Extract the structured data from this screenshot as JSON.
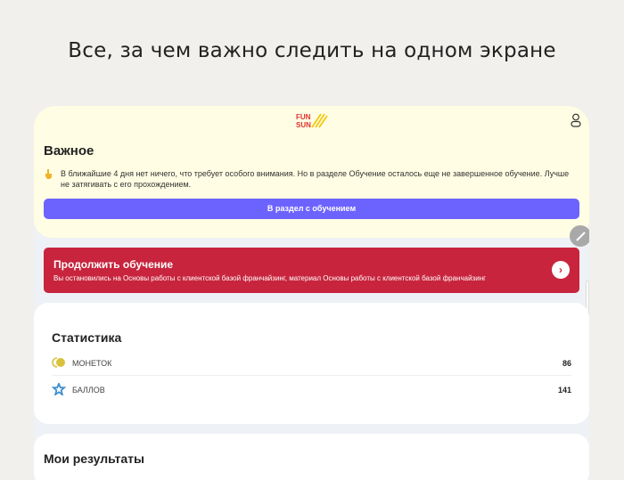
{
  "headline": "Все, за чем важно следить на одном экране",
  "logo": {
    "text_top": "FUN",
    "text_bottom": "SUN",
    "colors": {
      "red": "#e0302f",
      "yellow": "#f5c400"
    }
  },
  "important": {
    "title": "Важное",
    "message": "В ближайшие 4 дня нет ничего, что требует особого внимания. Но в разделе Обучение осталось еще не завершенное обучение. Лучше не затягивать с его прохождением.",
    "button": "В раздел с обучением"
  },
  "continue": {
    "title": "Продолжить обучение",
    "subtitle": "Вы остановились на Основы работы с клиентской базой франчайзинг, материал Основы работы с клиентской базой франчайзинг"
  },
  "stats": {
    "title": "Статистика",
    "items": [
      {
        "icon": "coins-icon",
        "label": "МОНЕТОК",
        "value": "86"
      },
      {
        "icon": "star-icon",
        "label": "БАЛЛОВ",
        "value": "141"
      }
    ]
  },
  "results": {
    "title": "Мои результаты"
  },
  "colors": {
    "accent": "#6c63ff",
    "red": "#c8243d",
    "yellow_bg": "#fffde3"
  }
}
